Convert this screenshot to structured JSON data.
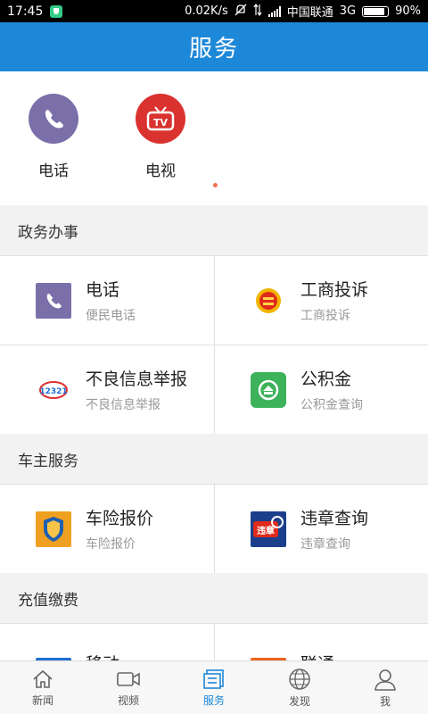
{
  "status_bar": {
    "time": "17:45",
    "net_speed": "0.02K/s",
    "carrier": "中国联通",
    "network": "3G",
    "battery": "90%",
    "battery_level": 0.9
  },
  "header": {
    "title": "服务"
  },
  "quick_access": [
    {
      "label": "电话",
      "icon": "phone-icon"
    },
    {
      "label": "电视",
      "icon": "tv-icon"
    }
  ],
  "sections": [
    {
      "title": "政务办事",
      "items": [
        {
          "title": "电话",
          "subtitle": "便民电话",
          "icon": "phone-icon"
        },
        {
          "title": "工商投诉",
          "subtitle": "工商投诉",
          "icon": "emblem-icon"
        },
        {
          "title": "不良信息举报",
          "subtitle": "不良信息举报",
          "icon": "report-icon"
        },
        {
          "title": "公积金",
          "subtitle": "公积金查询",
          "icon": "housing-fund-icon"
        }
      ]
    },
    {
      "title": "车主服务",
      "items": [
        {
          "title": "车险报价",
          "subtitle": "车险报价",
          "icon": "car-insurance-icon"
        },
        {
          "title": "违章查询",
          "subtitle": "违章查询",
          "icon": "violation-icon"
        }
      ]
    },
    {
      "title": "充值缴费",
      "items": [
        {
          "title": "移动",
          "subtitle": "",
          "icon": "mobile-carrier-icon"
        },
        {
          "title": "联通",
          "subtitle": "",
          "icon": "unicom-icon"
        }
      ]
    }
  ],
  "icon_labels": {
    "tv": "TV",
    "violation": "违章",
    "report": "12321"
  },
  "tabs": [
    {
      "label": "新闻",
      "icon": "home-icon"
    },
    {
      "label": "视频",
      "icon": "video-icon"
    },
    {
      "label": "服务",
      "icon": "service-icon",
      "active": true
    },
    {
      "label": "发现",
      "icon": "globe-icon"
    },
    {
      "label": "我",
      "icon": "person-icon"
    }
  ],
  "colors": {
    "accent": "#1e88d8",
    "header_bg": "#1e88d8"
  }
}
